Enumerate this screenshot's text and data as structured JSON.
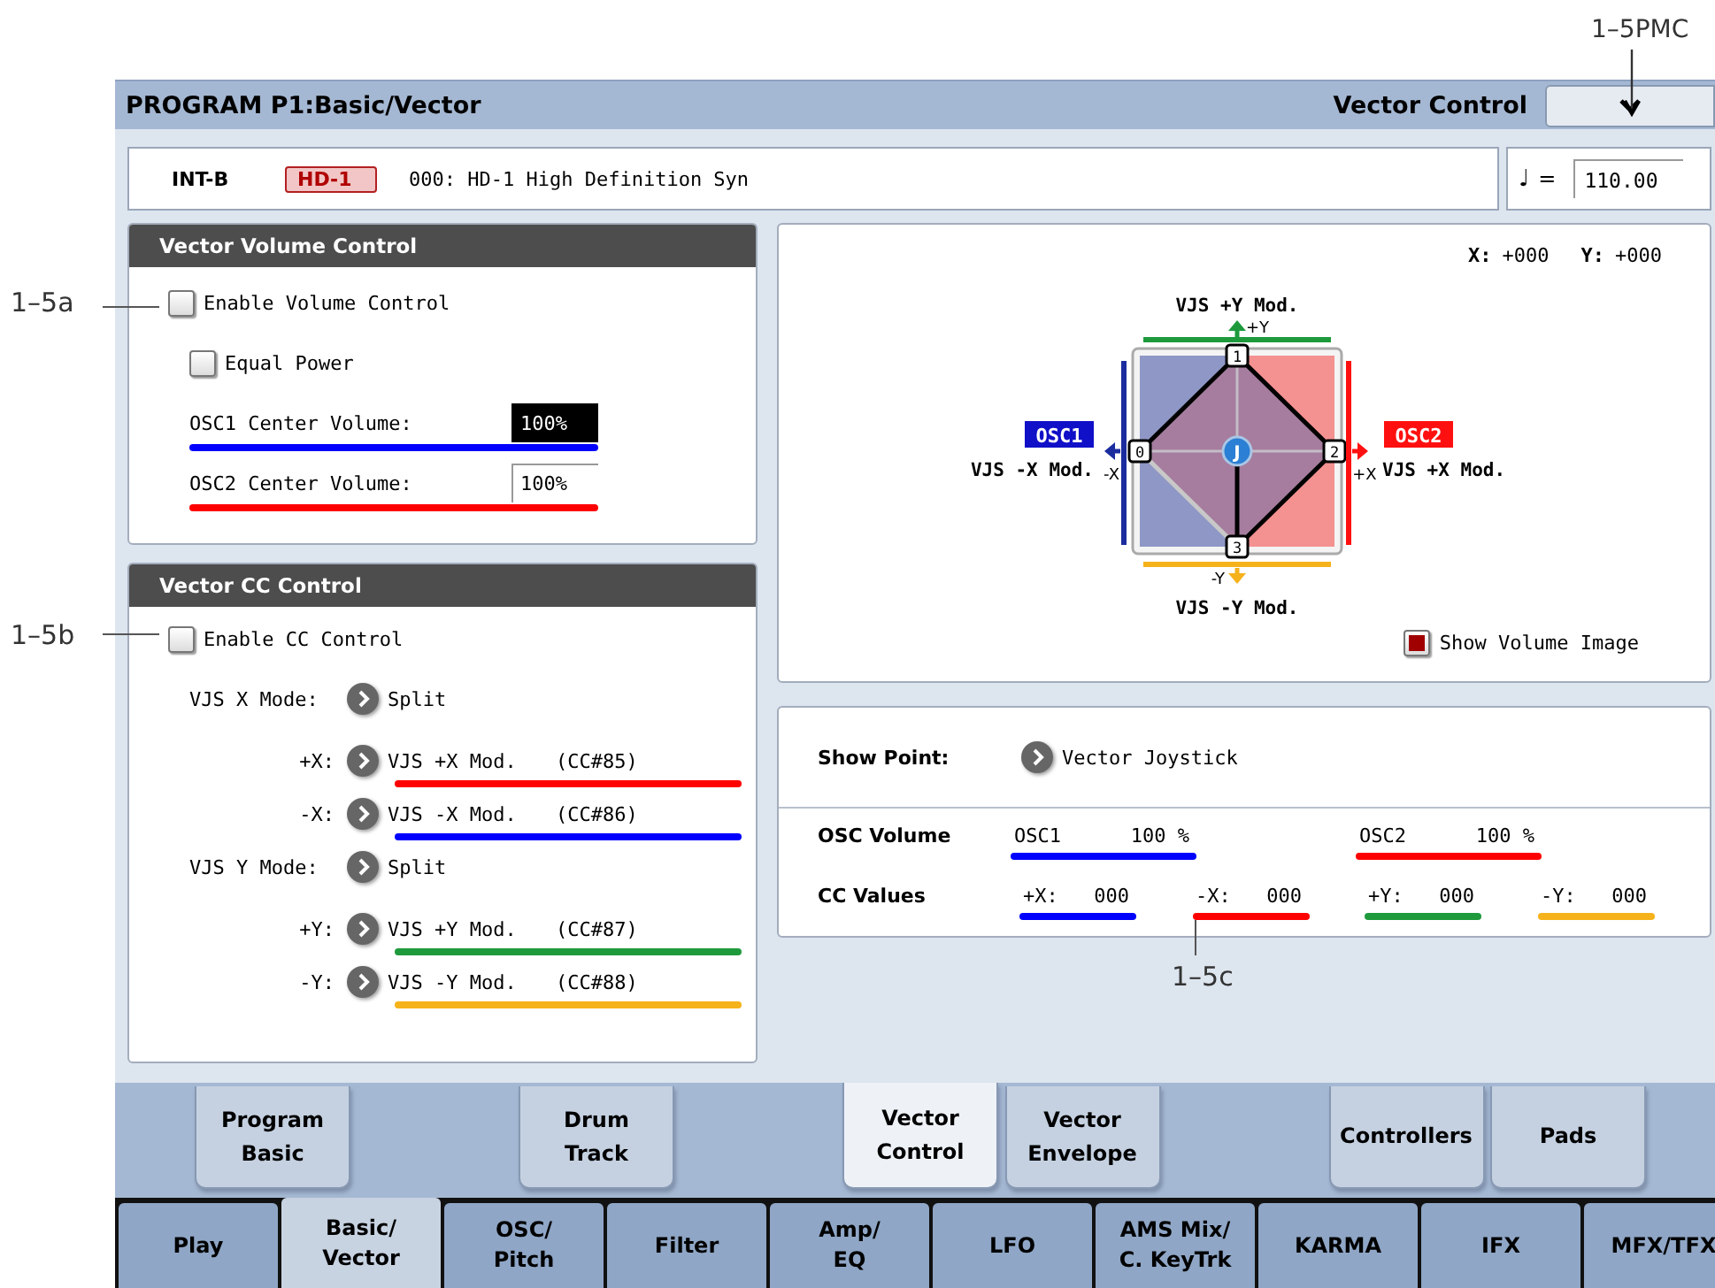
{
  "header": {
    "title": "PROGRAM P1:Basic/Vector",
    "page_label": "Vector Control"
  },
  "program": {
    "bank": "INT-B",
    "type_tag": "HD-1",
    "name": "000: HD-1 High Definition Syn"
  },
  "tempo": {
    "symbol": "♩",
    "equals": "=",
    "value": "110.00"
  },
  "volume_control": {
    "title": "Vector Volume Control",
    "checkboxes": [
      {
        "label": "Enable Volume Control",
        "checked": false
      },
      {
        "label": "Equal Power",
        "checked": false
      }
    ],
    "center_volumes": [
      {
        "label": "OSC1 Center Volume:",
        "value": "100%",
        "selected": true,
        "color": "#0000ff"
      },
      {
        "label": "OSC2 Center Volume:",
        "value": "100%",
        "selected": false,
        "color": "#ff0000"
      }
    ]
  },
  "cc_control": {
    "title": "Vector CC Control",
    "enable": {
      "label": "Enable CC Control",
      "checked": false
    },
    "rows": [
      {
        "kind": "mode",
        "label": "VJS X Mode:",
        "value": "Split"
      },
      {
        "kind": "assign",
        "label": "+X:",
        "value": "VJS +X Mod.",
        "cc": "(CC#85)",
        "color": "#ff0000"
      },
      {
        "kind": "assign",
        "label": "-X:",
        "value": "VJS -X Mod.",
        "cc": "(CC#86)",
        "color": "#0000ff"
      },
      {
        "kind": "mode",
        "label": "VJS Y Mode:",
        "value": "Split"
      },
      {
        "kind": "assign",
        "label": "+Y:",
        "value": "VJS +Y Mod.",
        "cc": "(CC#87)",
        "color": "#1e9a3c"
      },
      {
        "kind": "assign",
        "label": "-Y:",
        "value": "VJS -Y Mod.",
        "cc": "(CC#88)",
        "color": "#f5b21b"
      }
    ]
  },
  "vector_graph": {
    "x_label": "X:",
    "x_value": "+000",
    "y_label": "Y:",
    "y_value": "+000",
    "top_label": "VJS +Y Mod.",
    "top_axis": "+Y",
    "bottom_label": "VJS -Y Mod.",
    "bottom_axis": "-Y",
    "left_tag": "OSC1",
    "left_label": "VJS -X Mod.",
    "left_axis": "-X",
    "right_tag": "OSC2",
    "right_label": "VJS +X Mod.",
    "right_axis": "+X",
    "points": [
      "0",
      "1",
      "2",
      "3"
    ],
    "joystick": "J",
    "show_volume_image": {
      "label": "Show Volume Image",
      "checked": true
    }
  },
  "monitor": {
    "show_point": {
      "label": "Show Point:",
      "value": "Vector Joystick"
    },
    "osc_volume": {
      "label": "OSC Volume",
      "items": [
        {
          "name": "OSC1",
          "value": "100 %",
          "color": "#0000ff"
        },
        {
          "name": "OSC2",
          "value": "100 %",
          "color": "#ff0000"
        }
      ]
    },
    "cc_values": {
      "label": "CC Values",
      "items": [
        {
          "name": "+X:",
          "value": "000",
          "color": "#0000ff"
        },
        {
          "name": "-X:",
          "value": "000",
          "color": "#ff0000"
        },
        {
          "name": "+Y:",
          "value": "000",
          "color": "#1e9a3c"
        },
        {
          "name": "-Y:",
          "value": "000",
          "color": "#f5b21b"
        }
      ]
    }
  },
  "sub_tabs": [
    {
      "label": "Program\nBasic",
      "selected": false
    },
    {
      "label": "Drum\nTrack",
      "selected": false
    },
    {
      "label": "Vector\nControl",
      "selected": true
    },
    {
      "label": "Vector\nEnvelope",
      "selected": false
    },
    {
      "label": "Controllers",
      "selected": false
    },
    {
      "label": "Pads",
      "selected": false
    }
  ],
  "main_tabs": [
    {
      "label": "Play",
      "selected": false
    },
    {
      "label": "Basic/\nVector",
      "selected": true
    },
    {
      "label": "OSC/\nPitch",
      "selected": false
    },
    {
      "label": "Filter",
      "selected": false
    },
    {
      "label": "Amp/\nEQ",
      "selected": false
    },
    {
      "label": "LFO",
      "selected": false
    },
    {
      "label": "AMS Mix/\nC. KeyTrk",
      "selected": false
    },
    {
      "label": "KARMA",
      "selected": false
    },
    {
      "label": "IFX",
      "selected": false
    },
    {
      "label": "MFX/TFX",
      "selected": false
    }
  ],
  "callouts": [
    "1–5PMC",
    "1–5a",
    "1–5b",
    "1–5c"
  ]
}
